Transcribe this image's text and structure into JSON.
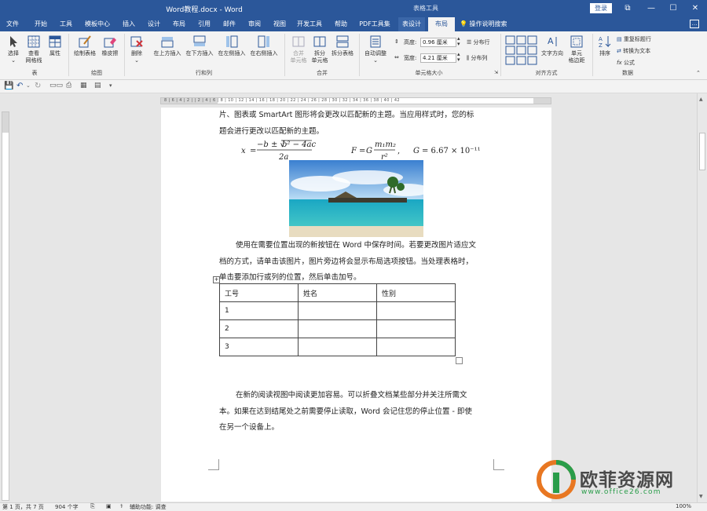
{
  "window": {
    "title": "Word教程.docx - Word",
    "context_label": "表格工具",
    "login_label": "登录",
    "restore_icon": "⧉",
    "min_icon": "—",
    "max_icon": "☐",
    "close_icon": "✕"
  },
  "tabs": [
    "文件",
    "开始",
    "工具",
    "模板中心",
    "插入",
    "设计",
    "布局",
    "引用",
    "邮件",
    "审阅",
    "视图",
    "开发工具",
    "帮助",
    "PDF工具集",
    "表设计",
    "布局"
  ],
  "tell_me": "操作说明搜索",
  "ribbon": {
    "select": "选择",
    "view_gridlines": "查看\n网格线",
    "properties": "属性",
    "draw_table": "绘制表格",
    "eraser": "橡皮擦",
    "delete": "删除",
    "insert_above": "在上方插入",
    "insert_below": "在下方插入",
    "insert_left": "在左侧插入",
    "insert_right": "在右侧插入",
    "merge_cells": "合并\n单元格",
    "split_cells": "拆分\n单元格",
    "split_table": "拆分表格",
    "autofit": "自动调整",
    "height_label": "高度:",
    "height_value": "0.96 厘米",
    "width_label": "宽度:",
    "width_value": "4.21 厘米",
    "distribute_rows": "分布行",
    "distribute_cols": "分布列",
    "text_direction": "文字方向",
    "cell_margins": "单元\n格边距",
    "sort": "排序",
    "repeat_header": "重复标题行",
    "convert_text": "转换为文本",
    "formula": "公式",
    "groups": {
      "table": "表",
      "draw": "绘图",
      "rows_cols": "行和列",
      "merge": "合并",
      "cell_size": "单元格大小",
      "alignment": "对齐方式",
      "data": "数据"
    }
  },
  "ruler_numbers": "8 | 6 | 4 | 2 | | 2 | 4 | 6 | 8 | 10 | 12 | 14 | 16 | 18 | 20 | 22 | 24 | 26 | 28 | 30 | 32 | 34 | 36 | 38 | 40 | 42",
  "document": {
    "p1_line1": "片、图表或 SmartArt 图形将会更改以匹配新的主题。当应用样式时，您的标",
    "p1_line2": "题会进行更改以匹配新的主题。",
    "p2_line1": "使用在需要位置出现的新按钮在 Word 中保存时间。若要更改图片适应文",
    "p2_line2": "档的方式，请单击该图片，图片旁边将会显示布局选项按钮。当处理表格时，",
    "p2_line3": "单击要添加行或列的位置，然后单击加号。",
    "table_header": [
      "工号",
      "姓名",
      "性别"
    ],
    "table_rows": [
      [
        "1",
        "",
        ""
      ],
      [
        "2",
        "",
        ""
      ],
      [
        "3",
        "",
        ""
      ]
    ],
    "p3_line1": "在新的阅读视图中阅读更加容易。可以折叠文档某些部分并关注所需文",
    "p3_line2": "本。如果在达到结尾处之前需要停止读取，Word 会记住您的停止位置 - 即使",
    "p3_line3": "在另一个设备上。"
  },
  "status": {
    "page": "第 1 页，共 7 页",
    "words": "904 个字",
    "accessibility": "辅助功能: 调查",
    "zoom": "100%"
  },
  "watermark": {
    "brand": "欧菲资源网",
    "url": "www.office26.com"
  },
  "colors": {
    "accent": "#2b579a",
    "brand_orange": "#e87722",
    "brand_green": "#2a9d4a"
  }
}
